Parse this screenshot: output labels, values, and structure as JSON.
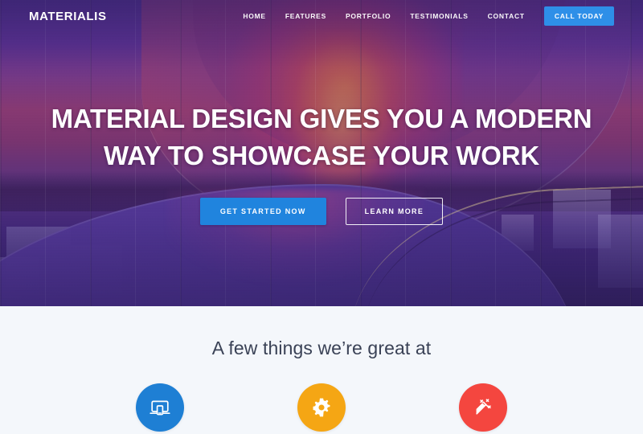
{
  "header": {
    "logo": "MATERIALIS",
    "nav_items": [
      {
        "label": "HOME"
      },
      {
        "label": "FEATURES"
      },
      {
        "label": "PORTFOLIO"
      },
      {
        "label": "TESTIMONIALS"
      },
      {
        "label": "CONTACT"
      }
    ],
    "cta_label": "CALL TODAY",
    "cta_color": "#2e8fe8"
  },
  "hero": {
    "title_line1": "MATERIAL DESIGN GIVES YOU A MODERN",
    "title_line2": "WAY TO SHOWCASE YOUR WORK",
    "primary_button": "GET STARTED NOW",
    "secondary_button": "LEARN MORE",
    "primary_color": "#2084de"
  },
  "features": {
    "heading": "A few things we’re great at",
    "heading_color": "#3a4256",
    "background_color": "#f4f7fb",
    "items": [
      {
        "icon": "responsive-devices-icon",
        "color": "#1e7fd4"
      },
      {
        "icon": "gear-icon",
        "color": "#f5a614"
      },
      {
        "icon": "magic-wand-icon",
        "color": "#f4463f"
      }
    ]
  }
}
